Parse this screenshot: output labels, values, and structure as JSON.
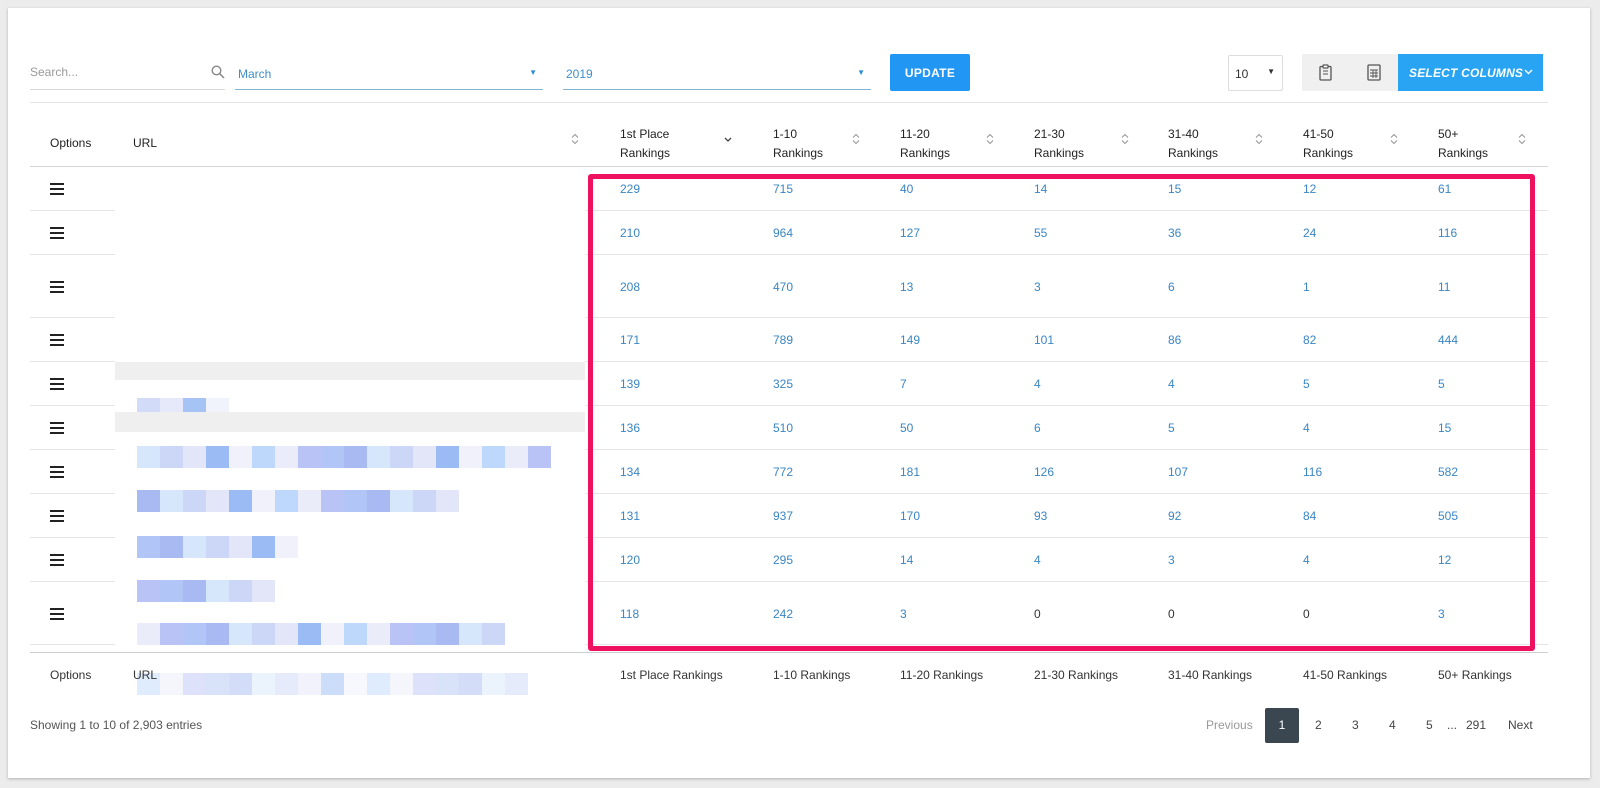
{
  "toolbar": {
    "search_placeholder": "Search...",
    "month_value": "March",
    "year_value": "2019",
    "update_label": "UPDATE",
    "per_page_value": "10",
    "select_columns_label": "SELECT COLUMNS"
  },
  "table": {
    "headers": {
      "options": "Options",
      "url": "URL",
      "first_line1": "1st Place",
      "first_line2": "Rankings",
      "r1_10_line1": "1-10",
      "r1_10_line2": "Rankings",
      "r11_20_line1": "11-20",
      "r11_20_line2": "Rankings",
      "r21_30_line1": "21-30",
      "r21_30_line2": "Rankings",
      "r31_40_line1": "31-40",
      "r31_40_line2": "Rankings",
      "r41_50_line1": "41-50",
      "r41_50_line2": "Rankings",
      "r50p_line1": "50+",
      "r50p_line2": "Rankings"
    },
    "rows": [
      [
        "229",
        "715",
        "40",
        "14",
        "15",
        "12",
        "61"
      ],
      [
        "210",
        "964",
        "127",
        "55",
        "36",
        "24",
        "116"
      ],
      [
        "208",
        "470",
        "13",
        "3",
        "6",
        "1",
        "11"
      ],
      [
        "171",
        "789",
        "149",
        "101",
        "86",
        "82",
        "444"
      ],
      [
        "139",
        "325",
        "7",
        "4",
        "4",
        "5",
        "5"
      ],
      [
        "136",
        "510",
        "50",
        "6",
        "5",
        "4",
        "15"
      ],
      [
        "134",
        "772",
        "181",
        "126",
        "107",
        "116",
        "582"
      ],
      [
        "131",
        "937",
        "170",
        "93",
        "92",
        "84",
        "505"
      ],
      [
        "120",
        "295",
        "14",
        "4",
        "3",
        "4",
        "12"
      ],
      [
        "118",
        "242",
        "3",
        "0",
        "0",
        "0",
        "3"
      ]
    ],
    "footer": {
      "options": "Options",
      "url": "URL",
      "first": "1st Place Rankings",
      "r1_10": "1-10 Rankings",
      "r11_20": "11-20 Rankings",
      "r21_30": "21-30 Rankings",
      "r31_40": "31-40 Rankings",
      "r41_50": "41-50 Rankings",
      "r50p": "50+ Rankings"
    }
  },
  "pagination": {
    "info": "Showing 1 to 10 of 2,903 entries",
    "previous": "Previous",
    "active": "1",
    "p2": "2",
    "p3": "3",
    "p4": "4",
    "p5": "5",
    "ellipsis": "...",
    "last": "291",
    "next": "Next"
  },
  "colors": {
    "accent": "#2196f3",
    "highlight_border": "#ee1160",
    "link_value": "#3a86c4"
  }
}
